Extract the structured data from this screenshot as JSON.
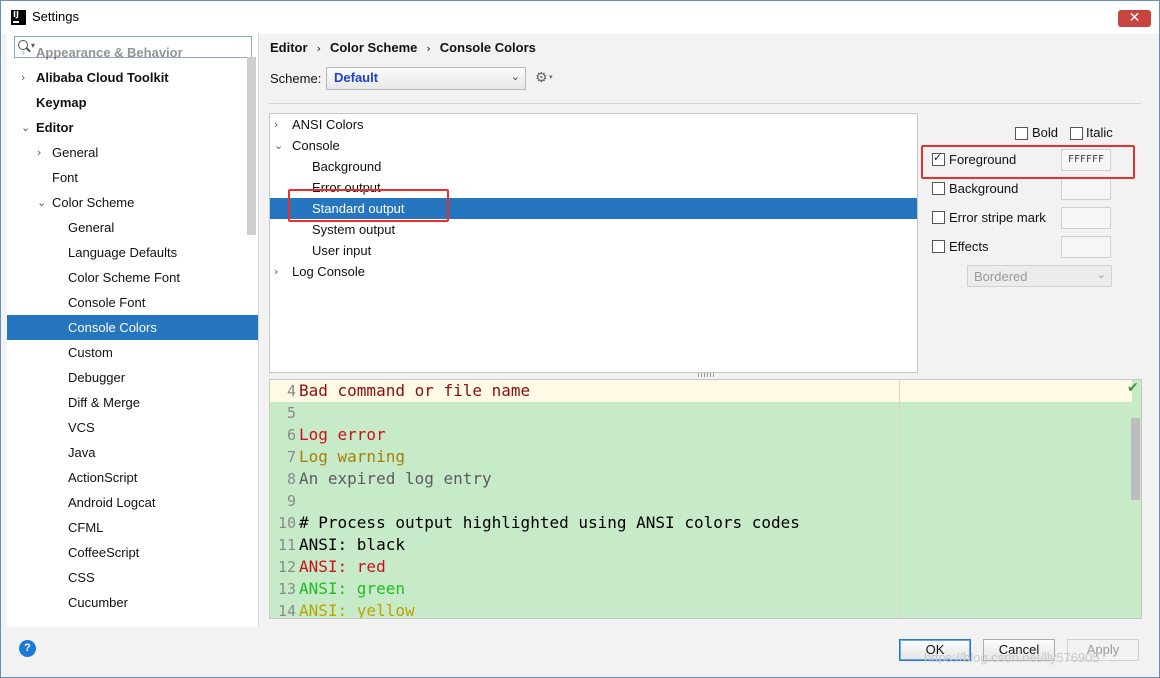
{
  "window": {
    "title": "Settings",
    "app_icon_text": "IJ",
    "close_glyph": "✕"
  },
  "search": {
    "placeholder": ""
  },
  "sidebar": {
    "items": [
      {
        "label": "Appearance & Behavior",
        "arrow": "›",
        "bold": true,
        "faded": true
      },
      {
        "label": "Alibaba Cloud Toolkit",
        "arrow": "›",
        "bold": true
      },
      {
        "label": "Keymap",
        "bold": true
      },
      {
        "label": "Editor",
        "arrow": "⌄",
        "bold": true
      },
      {
        "label": "General",
        "arrow": "›"
      },
      {
        "label": "Font"
      },
      {
        "label": "Color Scheme",
        "arrow": "⌄"
      },
      {
        "label": "General"
      },
      {
        "label": "Language Defaults"
      },
      {
        "label": "Color Scheme Font"
      },
      {
        "label": "Console Font"
      },
      {
        "label": "Console Colors",
        "selected": true
      },
      {
        "label": "Custom"
      },
      {
        "label": "Debugger"
      },
      {
        "label": "Diff & Merge"
      },
      {
        "label": "VCS"
      },
      {
        "label": "Java"
      },
      {
        "label": "ActionScript"
      },
      {
        "label": "Android Logcat"
      },
      {
        "label": "CFML"
      },
      {
        "label": "CoffeeScript"
      },
      {
        "label": "CSS"
      },
      {
        "label": "Cucumber"
      }
    ]
  },
  "breadcrumb": {
    "items": [
      "Editor",
      "Color Scheme",
      "Console Colors"
    ],
    "separator": "›"
  },
  "scheme": {
    "label": "Scheme:",
    "value": "Default",
    "chevron": "⌄",
    "gear_glyph": "⚙",
    "gear_caret": "▾"
  },
  "console_tree": {
    "items": [
      {
        "label": "ANSI Colors",
        "arrow": "›",
        "level": 0
      },
      {
        "label": "Console",
        "arrow": "⌄",
        "level": 0
      },
      {
        "label": "Background",
        "level": 1
      },
      {
        "label": "Error output",
        "level": 1
      },
      {
        "label": "Standard output",
        "level": 1,
        "selected": true
      },
      {
        "label": "System output",
        "level": 1
      },
      {
        "label": "User input",
        "level": 1
      },
      {
        "label": "Log Console",
        "arrow": "›",
        "level": 0
      }
    ]
  },
  "attributes": {
    "bold": {
      "label": "Bold",
      "checked": false
    },
    "italic": {
      "label": "Italic",
      "checked": false
    },
    "foreground": {
      "label": "Foreground",
      "checked": true,
      "value": "FFFFFF"
    },
    "background": {
      "label": "Background",
      "checked": false,
      "value": ""
    },
    "error_stripe": {
      "label": "Error stripe mark",
      "checked": false,
      "value": ""
    },
    "effects": {
      "label": "Effects",
      "checked": false,
      "value": ""
    },
    "effect_type": {
      "value": "Bordered",
      "chevron": "⌄"
    }
  },
  "preview": {
    "check_glyph": "✔",
    "lines": [
      {
        "num": "4",
        "text": "Bad command or file name",
        "color": "#8b0d0d",
        "current": true
      },
      {
        "num": "5",
        "text": "",
        "color": "#000000"
      },
      {
        "num": "6",
        "text": "Log error",
        "color": "#c8111a"
      },
      {
        "num": "7",
        "text": "Log warning",
        "color": "#a38209"
      },
      {
        "num": "8",
        "text": "An expired log entry",
        "color": "#5c5c5c"
      },
      {
        "num": "9",
        "text": "",
        "color": "#000000"
      },
      {
        "num": "10",
        "text": "# Process output highlighted using ANSI colors codes",
        "color": "#000000"
      },
      {
        "num": "11",
        "text": "ANSI: black",
        "color": "#000000"
      },
      {
        "num": "12",
        "text": "ANSI: red",
        "color": "#c8111a"
      },
      {
        "num": "13",
        "text": "ANSI: green",
        "color": "#22bb22"
      },
      {
        "num": "14",
        "text": "ANSI: yellow",
        "color": "#b8a400"
      }
    ]
  },
  "footer": {
    "help_glyph": "?",
    "ok_label": "OK",
    "cancel_label": "Cancel",
    "apply_label": "Apply",
    "watermark": "https://blog.csdn.net/lly576905"
  },
  "colors": {
    "selection": "#2675bf",
    "highlight_box": "#e8312f",
    "preview_bg": "#c7ebc9",
    "scheme_value": "#1f3fd1"
  }
}
